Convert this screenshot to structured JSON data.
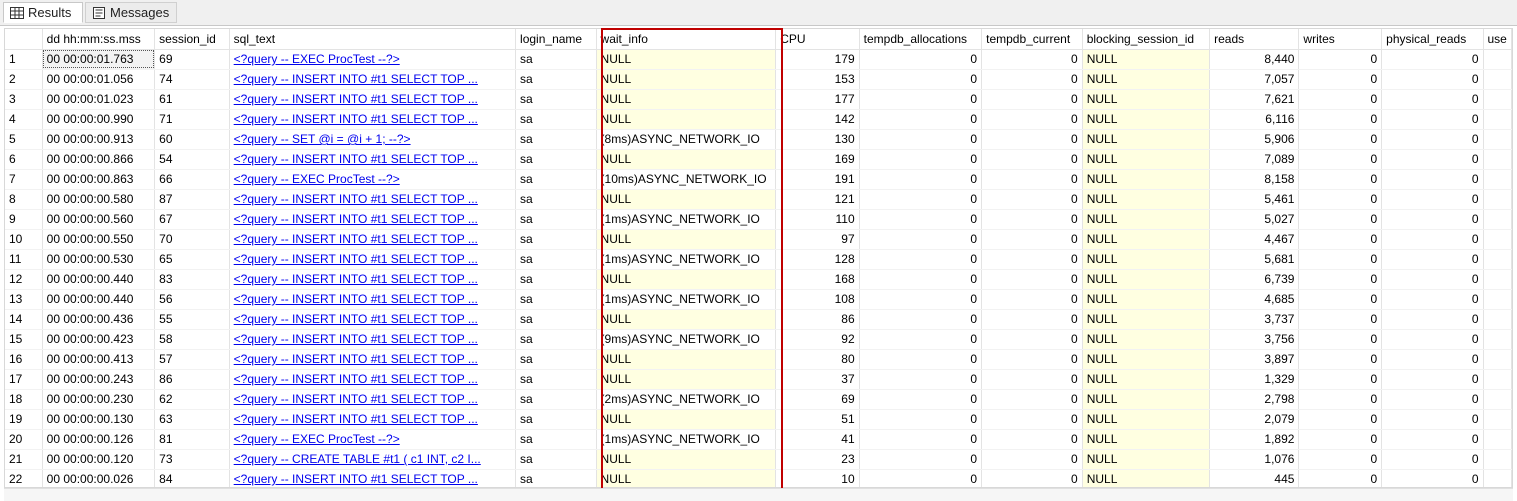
{
  "tabs": [
    {
      "label": "Results",
      "icon": "grid-icon"
    },
    {
      "label": "Messages",
      "icon": "messages-icon"
    }
  ],
  "columns": [
    "dd hh:mm:ss.mss",
    "session_id",
    "sql_text",
    "login_name",
    "wait_info",
    "CPU",
    "tempdb_allocations",
    "tempdb_current",
    "blocking_session_id",
    "reads",
    "writes",
    "physical_reads",
    "use"
  ],
  "rows": [
    [
      "1",
      "00 00:00:01.763",
      "69",
      "<?query --  EXEC ProcTest  --?>",
      "sa",
      "NULL",
      "179",
      "0",
      "0",
      "NULL",
      "8,440",
      "0",
      "0"
    ],
    [
      "2",
      "00 00:00:01.056",
      "74",
      "<?query --  INSERT INTO #t1        SELECT TOP ...",
      "sa",
      "NULL",
      "153",
      "0",
      "0",
      "NULL",
      "7,057",
      "0",
      "0"
    ],
    [
      "3",
      "00 00:00:01.023",
      "61",
      "<?query --  INSERT INTO #t1        SELECT TOP ...",
      "sa",
      "NULL",
      "177",
      "0",
      "0",
      "NULL",
      "7,621",
      "0",
      "0"
    ],
    [
      "4",
      "00 00:00:00.990",
      "71",
      "<?query --  INSERT INTO #t1        SELECT TOP ...",
      "sa",
      "NULL",
      "142",
      "0",
      "0",
      "NULL",
      "6,116",
      "0",
      "0"
    ],
    [
      "5",
      "00 00:00:00.913",
      "60",
      "<?query --  SET @i = @i + 1;        --?>",
      "sa",
      "(8ms)ASYNC_NETWORK_IO",
      "130",
      "0",
      "0",
      "NULL",
      "5,906",
      "0",
      "0"
    ],
    [
      "6",
      "00 00:00:00.866",
      "54",
      "<?query --  INSERT INTO #t1        SELECT TOP ...",
      "sa",
      "NULL",
      "169",
      "0",
      "0",
      "NULL",
      "7,089",
      "0",
      "0"
    ],
    [
      "7",
      "00 00:00:00.863",
      "66",
      "<?query --  EXEC ProcTest  --?>",
      "sa",
      "(10ms)ASYNC_NETWORK_IO",
      "191",
      "0",
      "0",
      "NULL",
      "8,158",
      "0",
      "0"
    ],
    [
      "8",
      "00 00:00:00.580",
      "87",
      "<?query --  INSERT INTO #t1        SELECT TOP ...",
      "sa",
      "NULL",
      "121",
      "0",
      "0",
      "NULL",
      "5,461",
      "0",
      "0"
    ],
    [
      "9",
      "00 00:00:00.560",
      "67",
      "<?query --  INSERT INTO #t1        SELECT TOP ...",
      "sa",
      "(1ms)ASYNC_NETWORK_IO",
      "110",
      "0",
      "0",
      "NULL",
      "5,027",
      "0",
      "0"
    ],
    [
      "10",
      "00 00:00:00.550",
      "70",
      "<?query --  INSERT INTO #t1        SELECT TOP ...",
      "sa",
      "NULL",
      "97",
      "0",
      "0",
      "NULL",
      "4,467",
      "0",
      "0"
    ],
    [
      "11",
      "00 00:00:00.530",
      "65",
      "<?query --  INSERT INTO #t1        SELECT TOP ...",
      "sa",
      "(1ms)ASYNC_NETWORK_IO",
      "128",
      "0",
      "0",
      "NULL",
      "5,681",
      "0",
      "0"
    ],
    [
      "12",
      "00 00:00:00.440",
      "83",
      "<?query --  INSERT INTO #t1        SELECT TOP ...",
      "sa",
      "NULL",
      "168",
      "0",
      "0",
      "NULL",
      "6,739",
      "0",
      "0"
    ],
    [
      "13",
      "00 00:00:00.440",
      "56",
      "<?query --  INSERT INTO #t1        SELECT TOP ...",
      "sa",
      "(1ms)ASYNC_NETWORK_IO",
      "108",
      "0",
      "0",
      "NULL",
      "4,685",
      "0",
      "0"
    ],
    [
      "14",
      "00 00:00:00.436",
      "55",
      "<?query --  INSERT INTO #t1        SELECT TOP ...",
      "sa",
      "NULL",
      "86",
      "0",
      "0",
      "NULL",
      "3,737",
      "0",
      "0"
    ],
    [
      "15",
      "00 00:00:00.423",
      "58",
      "<?query --  INSERT INTO #t1        SELECT TOP ...",
      "sa",
      "(9ms)ASYNC_NETWORK_IO",
      "92",
      "0",
      "0",
      "NULL",
      "3,756",
      "0",
      "0"
    ],
    [
      "16",
      "00 00:00:00.413",
      "57",
      "<?query --  INSERT INTO #t1        SELECT TOP ...",
      "sa",
      "NULL",
      "80",
      "0",
      "0",
      "NULL",
      "3,897",
      "0",
      "0"
    ],
    [
      "17",
      "00 00:00:00.243",
      "86",
      "<?query --  INSERT INTO #t1        SELECT TOP ...",
      "sa",
      "NULL",
      "37",
      "0",
      "0",
      "NULL",
      "1,329",
      "0",
      "0"
    ],
    [
      "18",
      "00 00:00:00.230",
      "62",
      "<?query --  INSERT INTO #t1        SELECT TOP ...",
      "sa",
      "(2ms)ASYNC_NETWORK_IO",
      "69",
      "0",
      "0",
      "NULL",
      "2,798",
      "0",
      "0"
    ],
    [
      "19",
      "00 00:00:00.130",
      "63",
      "<?query --  INSERT INTO #t1        SELECT TOP ...",
      "sa",
      "NULL",
      "51",
      "0",
      "0",
      "NULL",
      "2,079",
      "0",
      "0"
    ],
    [
      "20",
      "00 00:00:00.126",
      "81",
      "<?query --  EXEC ProcTest  --?>",
      "sa",
      "(1ms)ASYNC_NETWORK_IO",
      "41",
      "0",
      "0",
      "NULL",
      "1,892",
      "0",
      "0"
    ],
    [
      "21",
      "00 00:00:00.120",
      "73",
      "<?query --  CREATE TABLE #t1  (    c1 INT,     c2 I...",
      "sa",
      "NULL",
      "23",
      "0",
      "0",
      "NULL",
      "1,076",
      "0",
      "0"
    ],
    [
      "22",
      "00 00:00:00.026",
      "84",
      "<?query --  INSERT INTO #t1        SELECT TOP ...",
      "sa",
      "NULL",
      "10",
      "0",
      "0",
      "NULL",
      "445",
      "0",
      "0"
    ]
  ],
  "colors": {
    "null_cell": "#ffffe1",
    "highlight_border": "#c00000",
    "link": "#0000ee"
  }
}
